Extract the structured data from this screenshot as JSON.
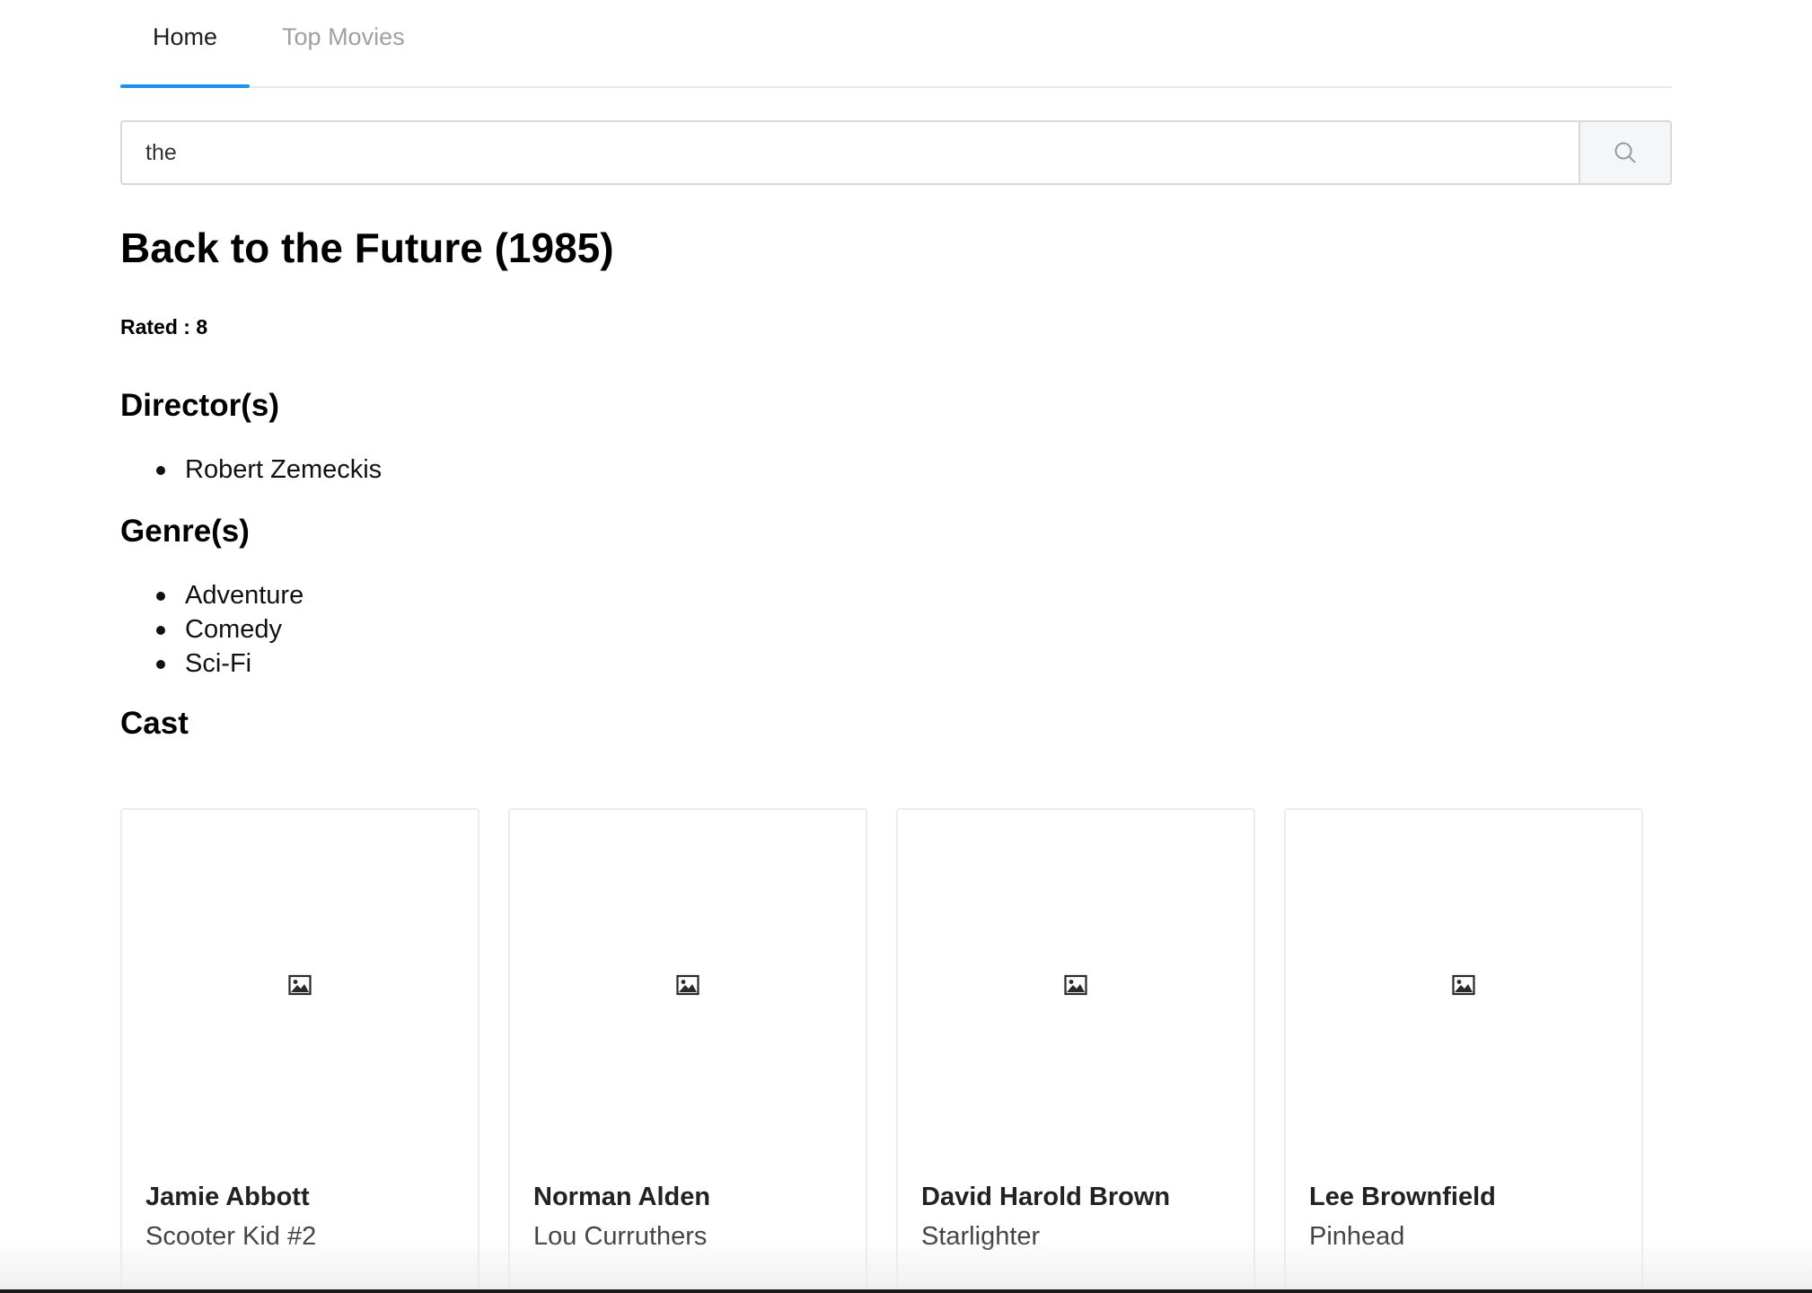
{
  "tabs": [
    {
      "label": "Home",
      "active": true
    },
    {
      "label": "Top Movies",
      "active": false
    }
  ],
  "search": {
    "value": "the",
    "placeholder": "",
    "button_icon": "search-icon"
  },
  "movie": {
    "title": "Back to the Future (1985)",
    "rating": "Rated : 8",
    "directors_heading": "Director(s)",
    "directors": [
      "Robert Zemeckis"
    ],
    "genres_heading": "Genre(s)",
    "genres": [
      "Adventure",
      "Comedy",
      "Sci-Fi"
    ],
    "cast_heading": "Cast"
  },
  "cast": [
    {
      "actor": "Jamie Abbott",
      "character": "Scooter Kid #2",
      "photo_icon": "image-placeholder-icon"
    },
    {
      "actor": "Norman Alden",
      "character": "Lou Curruthers",
      "photo_icon": "image-placeholder-icon"
    },
    {
      "actor": "David Harold Brown",
      "character": "Starlighter",
      "photo_icon": "image-placeholder-icon"
    },
    {
      "actor": "Lee Brownfield",
      "character": "Pinhead",
      "photo_icon": "image-placeholder-icon"
    }
  ],
  "colors": {
    "accent": "#1890ff",
    "border": "#d9d9d9",
    "inactive_tab": "#a0a0a0"
  }
}
